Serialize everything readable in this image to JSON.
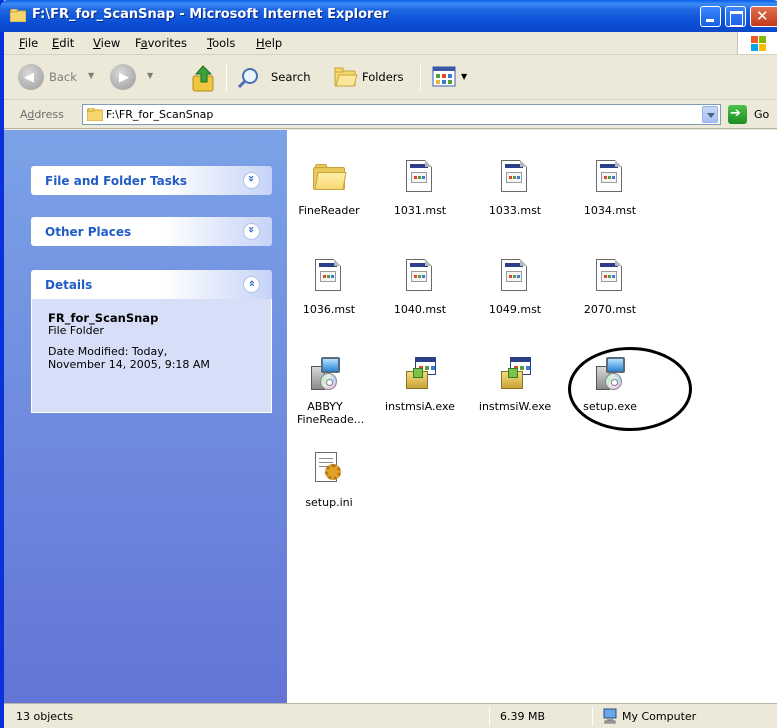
{
  "window": {
    "title": "F:\\FR_for_ScanSnap - Microsoft Internet Explorer"
  },
  "menu": [
    {
      "u": "F",
      "rest": "ile"
    },
    {
      "u": "E",
      "rest": "dit"
    },
    {
      "u": "V",
      "rest": "iew"
    },
    {
      "u": "a",
      "pre": "F",
      "rest": "vorites"
    },
    {
      "u": "T",
      "rest": "ools"
    },
    {
      "u": "H",
      "rest": "elp"
    }
  ],
  "toolbar": {
    "back_label": "Back",
    "search_label": "Search",
    "folders_label": "Folders"
  },
  "address": {
    "label_u": "d",
    "label_pre": "A",
    "label_rest": "dress",
    "value": "F:\\FR_for_ScanSnap",
    "go_label": "Go"
  },
  "taskpane": {
    "panels": [
      {
        "title": "File and Folder Tasks",
        "state": "collapsed"
      },
      {
        "title": "Other Places",
        "state": "collapsed"
      },
      {
        "title": "Details",
        "state": "expanded"
      }
    ],
    "details": {
      "name": "FR_for_ScanSnap",
      "type": "File Folder",
      "date_line1": "Date Modified: Today,",
      "date_line2": "November 14, 2005, 9:18 AM"
    }
  },
  "files": [
    {
      "name": "FineReader",
      "icon": "folder-icon"
    },
    {
      "name": "1031.mst",
      "icon": "mst-file-icon"
    },
    {
      "name": "1033.mst",
      "icon": "mst-file-icon"
    },
    {
      "name": "1034.mst",
      "icon": "mst-file-icon"
    },
    {
      "name": "1036.mst",
      "icon": "mst-file-icon"
    },
    {
      "name": "1040.mst",
      "icon": "mst-file-icon"
    },
    {
      "name": "1049.mst",
      "icon": "mst-file-icon"
    },
    {
      "name": "2070.mst",
      "icon": "mst-file-icon"
    },
    {
      "name": "ABBYY FineReade...",
      "icon": "setup-icon"
    },
    {
      "name": "instmsiA.exe",
      "icon": "installer-icon"
    },
    {
      "name": "instmsiW.exe",
      "icon": "installer-icon"
    },
    {
      "name": "setup.exe",
      "icon": "setup-icon",
      "highlighted": true
    },
    {
      "name": "setup.ini",
      "icon": "ini-file-icon"
    }
  ],
  "status": {
    "objects": "13 objects",
    "size": "6.39 MB",
    "zone": "My Computer"
  }
}
